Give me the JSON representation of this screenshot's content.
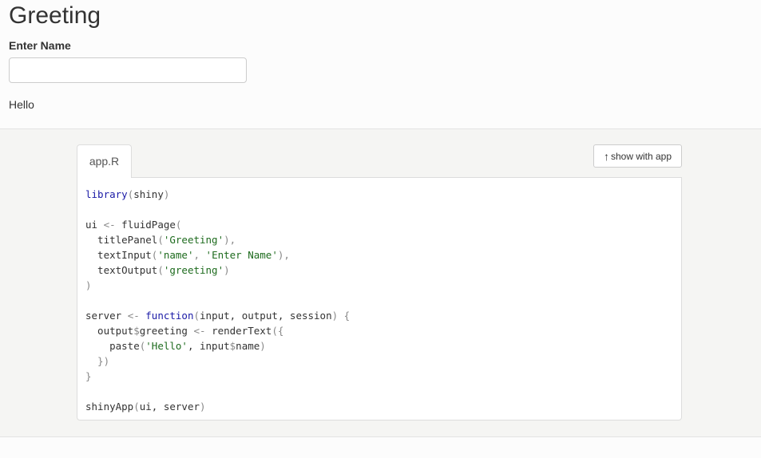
{
  "app": {
    "title": "Greeting",
    "input_label": "Enter Name",
    "input_value": "",
    "input_placeholder": "",
    "output_text": "Hello"
  },
  "code_viewer": {
    "tab_label": "app.R",
    "show_button_label": "show with app",
    "show_button_icon": "arrow-up-icon",
    "lines": [
      [
        {
          "t": "library",
          "c": "kw"
        },
        {
          "t": "(",
          "c": "punc"
        },
        {
          "t": "shiny"
        },
        {
          "t": ")",
          "c": "punc"
        }
      ],
      [],
      [
        {
          "t": "ui "
        },
        {
          "t": "<-",
          "c": "punc"
        },
        {
          "t": " fluidPage"
        },
        {
          "t": "(",
          "c": "punc"
        }
      ],
      [
        {
          "t": "  titlePanel"
        },
        {
          "t": "(",
          "c": "punc"
        },
        {
          "t": "'Greeting'",
          "c": "str"
        },
        {
          "t": "),",
          "c": "punc"
        }
      ],
      [
        {
          "t": "  textInput"
        },
        {
          "t": "(",
          "c": "punc"
        },
        {
          "t": "'name'",
          "c": "str"
        },
        {
          "t": ", ",
          "c": "punc"
        },
        {
          "t": "'Enter Name'",
          "c": "str"
        },
        {
          "t": "),",
          "c": "punc"
        }
      ],
      [
        {
          "t": "  textOutput"
        },
        {
          "t": "(",
          "c": "punc"
        },
        {
          "t": "'greeting'",
          "c": "str"
        },
        {
          "t": ")",
          "c": "punc"
        }
      ],
      [
        {
          "t": ")",
          "c": "punc"
        }
      ],
      [],
      [
        {
          "t": "server "
        },
        {
          "t": "<-",
          "c": "punc"
        },
        {
          "t": " "
        },
        {
          "t": "function",
          "c": "kw"
        },
        {
          "t": "(",
          "c": "punc"
        },
        {
          "t": "input, output, session"
        },
        {
          "t": ") {",
          "c": "punc"
        }
      ],
      [
        {
          "t": "  output"
        },
        {
          "t": "$",
          "c": "punc"
        },
        {
          "t": "greeting "
        },
        {
          "t": "<-",
          "c": "punc"
        },
        {
          "t": " renderText"
        },
        {
          "t": "({",
          "c": "punc"
        }
      ],
      [
        {
          "t": "    paste"
        },
        {
          "t": "(",
          "c": "punc"
        },
        {
          "t": "'Hello'",
          "c": "str"
        },
        {
          "t": ", input"
        },
        {
          "t": "$",
          "c": "punc"
        },
        {
          "t": "name"
        },
        {
          "t": ")",
          "c": "punc"
        }
      ],
      [
        {
          "t": "  })",
          "c": "punc"
        }
      ],
      [
        {
          "t": "}",
          "c": "punc"
        }
      ],
      [],
      [
        {
          "t": "shinyApp"
        },
        {
          "t": "(",
          "c": "punc"
        },
        {
          "t": "ui, server"
        },
        {
          "t": ")",
          "c": "punc"
        }
      ]
    ]
  }
}
